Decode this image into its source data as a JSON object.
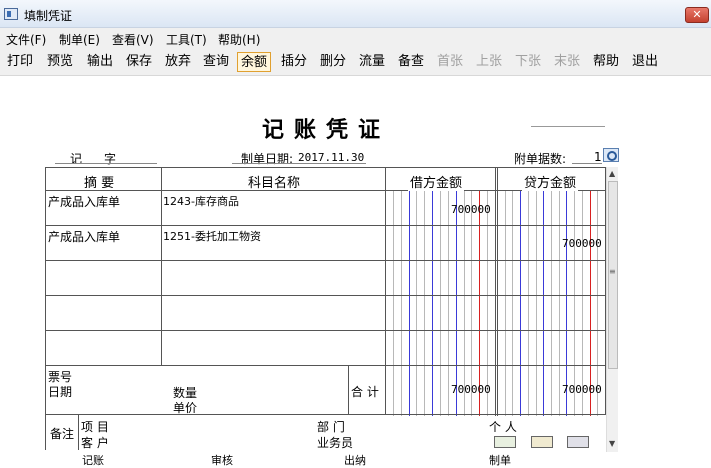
{
  "window": {
    "title": "填制凭证",
    "close_label": "✕"
  },
  "menu": [
    "文件(F)",
    "制单(E)",
    "查看(V)",
    "工具(T)",
    "帮助(H)"
  ],
  "toolbar": [
    {
      "label": "打印",
      "state": "normal"
    },
    {
      "label": "预览",
      "state": "normal"
    },
    {
      "label": "输出",
      "state": "normal"
    },
    {
      "label": "保存",
      "state": "normal"
    },
    {
      "label": "放弃",
      "state": "normal"
    },
    {
      "label": "查询",
      "state": "normal"
    },
    {
      "label": "余额",
      "state": "active"
    },
    {
      "label": "插分",
      "state": "normal"
    },
    {
      "label": "删分",
      "state": "normal"
    },
    {
      "label": "流量",
      "state": "normal"
    },
    {
      "label": "备查",
      "state": "normal"
    },
    {
      "label": "首张",
      "state": "disabled"
    },
    {
      "label": "上张",
      "state": "disabled"
    },
    {
      "label": "下张",
      "state": "disabled"
    },
    {
      "label": "末张",
      "state": "disabled"
    },
    {
      "label": "帮助",
      "state": "normal"
    },
    {
      "label": "退出",
      "state": "normal"
    }
  ],
  "voucher": {
    "title": "记账凭证",
    "type_label": "记",
    "zi_label": "字",
    "date_label": "制单日期:",
    "date_value": "2017.11.30",
    "attach_label": "附单据数:",
    "attach_value": "1",
    "headers": {
      "summary": "摘 要",
      "account": "科目名称",
      "debit": "借方金额",
      "credit": "贷方金额"
    },
    "entries": [
      {
        "summary": "产成品入库单",
        "account": "1243-库存商品",
        "debit": "700000",
        "credit": ""
      },
      {
        "summary": "产成品入库单",
        "account": "1251-委托加工物资",
        "debit": "",
        "credit": "700000"
      }
    ],
    "footer": {
      "ticket_no_label": "票号",
      "date_label": "日期",
      "quantity_label": "数量",
      "unit_price_label": "单价",
      "total_label": "合 计",
      "total_debit": "700000",
      "total_credit": "700000"
    },
    "remarks": {
      "label": "备注",
      "project_label": "项  目",
      "customer_label": "客  户",
      "dept_label": "部  门",
      "salesperson_label": "业务员",
      "person_label": "个  人"
    },
    "bottom_cut": {
      "bookkeeping": "记账",
      "review": "审核",
      "cashier": "出纳",
      "maker": "制单"
    }
  },
  "colors": {
    "grid_blue": "#3a3ad8",
    "grid_red": "#d82020",
    "grid_gray": "#b8b8b8",
    "active_border": "#e0a030"
  }
}
